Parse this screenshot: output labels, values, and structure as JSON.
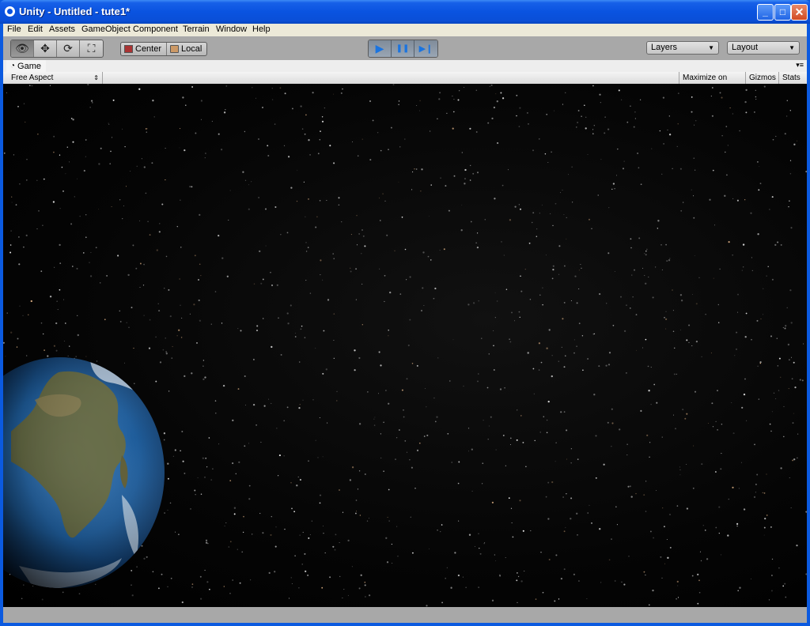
{
  "window": {
    "title": "Unity - Untitled - tute1*",
    "minimize_glyph": "_",
    "maximize_glyph": "□",
    "close_glyph": "✕"
  },
  "menu": [
    "File",
    "Edit",
    "Assets",
    "GameObject",
    "Component",
    "Terrain",
    "Window",
    "Help"
  ],
  "toolbar": {
    "transform_tools": [
      {
        "name": "view-tool",
        "icon": "eye-icon",
        "glyph": "👁",
        "active": true
      },
      {
        "name": "move-tool",
        "icon": "move-icon",
        "glyph": "✥",
        "active": false
      },
      {
        "name": "rotate-tool",
        "icon": "rotate-icon",
        "glyph": "⟳",
        "active": false
      },
      {
        "name": "scale-tool",
        "icon": "scale-icon",
        "glyph": "⛶",
        "active": false
      }
    ],
    "pivot_label": "Center",
    "space_label": "Local",
    "play_glyph": "▶",
    "pause_glyph": "❚❚",
    "step_glyph": "▶❙",
    "layers_label": "Layers",
    "layout_label": "Layout",
    "dropdown_arrow": "▼"
  },
  "game_panel": {
    "tab_label": "Game",
    "menu_glyph": "▾≡",
    "aspect_label": "Free Aspect",
    "aspect_arrow": "⇕",
    "maximize_label": "Maximize on Play",
    "gizmos_label": "Gizmos",
    "stats_label": "Stats"
  },
  "scene": {
    "background": "#000000",
    "star_color": "#ffffff",
    "planet_ocean": "#1d5f9e",
    "planet_land": "#6b6a3a"
  }
}
